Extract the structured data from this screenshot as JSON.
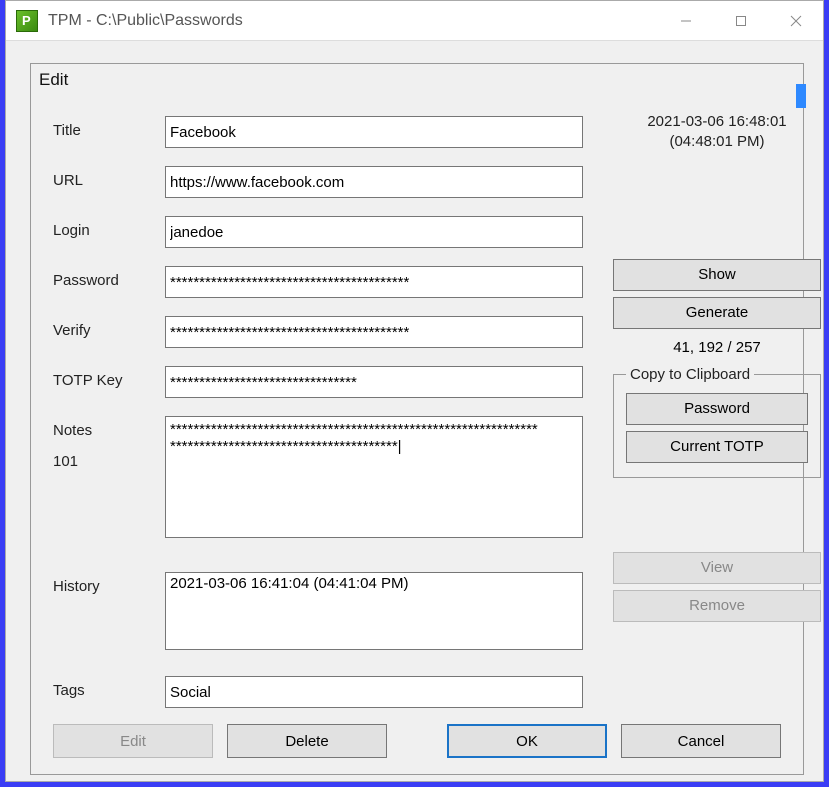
{
  "window": {
    "title": "TPM - C:\\Public\\Passwords"
  },
  "dialog": {
    "heading": "Edit"
  },
  "labels": {
    "title": "Title",
    "url": "URL",
    "login": "Login",
    "password": "Password",
    "verify": "Verify",
    "totp": "TOTP Key",
    "notes": "Notes",
    "notes_count": "101",
    "history": "History",
    "tags": "Tags"
  },
  "fields": {
    "title": "Facebook",
    "url": "https://www.facebook.com",
    "login": "janedoe",
    "password": "*****************************************",
    "verify": "*****************************************",
    "totp": "********************************",
    "notes": "***************************************************************\n***************************************|",
    "tags": "Social"
  },
  "history": {
    "items": [
      "2021-03-06 16:41:04 (04:41:04 PM)"
    ]
  },
  "timestamp": {
    "line1": "2021-03-06 16:48:01",
    "line2": "(04:48:01 PM)"
  },
  "buttons": {
    "show": "Show",
    "generate": "Generate",
    "password_clip": "Password",
    "totp_clip": "Current TOTP",
    "view": "View",
    "remove": "Remove",
    "edit": "Edit",
    "delete": "Delete",
    "ok": "OK",
    "cancel": "Cancel"
  },
  "groupbox": {
    "clipboard": "Copy to Clipboard"
  },
  "stats": {
    "text": "41, 192 / 257"
  }
}
